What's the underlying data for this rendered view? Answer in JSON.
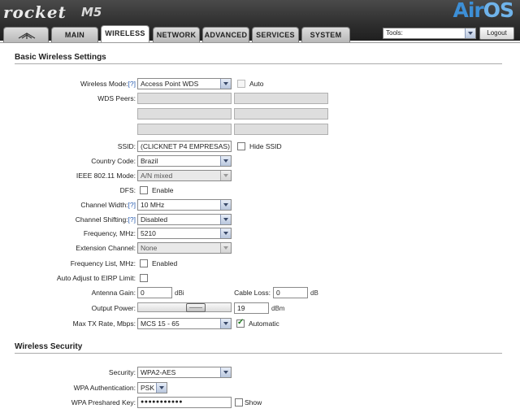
{
  "header": {
    "product": "rocket",
    "model": "M5",
    "brand_air": "Air",
    "brand_os": "OS"
  },
  "tabs": [
    {
      "label": "MAIN"
    },
    {
      "label": "WIRELESS"
    },
    {
      "label": "NETWORK"
    },
    {
      "label": "ADVANCED"
    },
    {
      "label": "SERVICES"
    },
    {
      "label": "SYSTEM"
    }
  ],
  "tools": {
    "value": "Tools:"
  },
  "logout_label": "Logout",
  "basic": {
    "title": "Basic Wireless Settings",
    "help": "[?]",
    "wireless_mode_label": "Wireless Mode:",
    "wireless_mode_value": "Access Point WDS",
    "auto_label": "Auto",
    "wds_peers_label": "WDS Peers:",
    "ssid_label": "SSID:",
    "ssid_value": "(CLICKNET P4 EMPRESAS)",
    "hide_ssid_label": "Hide SSID",
    "country_label": "Country Code:",
    "country_value": "Brazil",
    "ieee_label": "IEEE 802.11 Mode:",
    "ieee_value": "A/N mixed",
    "dfs_label": "DFS:",
    "dfs_enable_label": "Enable",
    "channel_width_label": "Channel Width:",
    "channel_width_value": "10 MHz",
    "channel_shifting_label": "Channel Shifting:",
    "channel_shifting_value": "Disabled",
    "frequency_label": "Frequency, MHz:",
    "frequency_value": "5210",
    "extension_label": "Extension Channel:",
    "extension_value": "None",
    "freq_list_label": "Frequency List, MHz:",
    "freq_list_enabled_label": "Enabled",
    "eirp_label": "Auto Adjust to EIRP Limit:",
    "antenna_gain_label": "Antenna Gain:",
    "antenna_gain_value": "0",
    "antenna_gain_unit": "dBi",
    "cable_loss_label": "Cable Loss:",
    "cable_loss_value": "0",
    "cable_loss_unit": "dB",
    "output_power_label": "Output Power:",
    "output_power_value": "19",
    "output_power_unit": "dBm",
    "output_power_level": 0.66,
    "max_tx_label": "Max TX Rate, Mbps:",
    "max_tx_value": "MCS 15 - 65",
    "automatic_label": "Automatic"
  },
  "security": {
    "title": "Wireless Security",
    "security_label": "Security:",
    "security_value": "WPA2-AES",
    "wpa_auth_label": "WPA Authentication:",
    "wpa_auth_value": "PSK",
    "wpa_key_label": "WPA Preshared Key:",
    "wpa_key_value": "●●●●●●●●●●●",
    "show_label": "Show"
  }
}
